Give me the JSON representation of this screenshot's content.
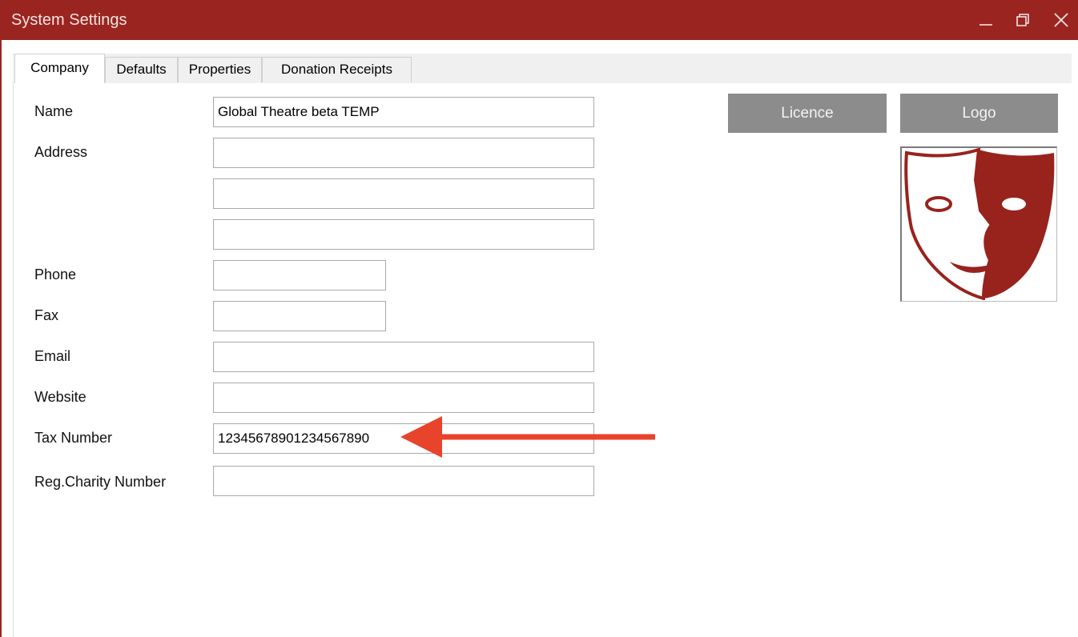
{
  "window": {
    "title": "System Settings",
    "accent_color": "#9a2520",
    "controls": [
      "minimize-icon",
      "restore-icon",
      "close-icon"
    ]
  },
  "tabs": [
    {
      "label": "Company",
      "active": true
    },
    {
      "label": "Defaults",
      "active": false
    },
    {
      "label": "Properties",
      "active": false
    },
    {
      "label": "Donation Receipts",
      "active": false
    }
  ],
  "form": {
    "name_label": "Name",
    "name_value": "Global Theatre beta TEMP",
    "address_label": "Address",
    "address_line1": "",
    "address_line2": "",
    "address_line3": "",
    "phone_label": "Phone",
    "phone_value": "",
    "fax_label": "Fax",
    "fax_value": "",
    "email_label": "Email",
    "email_value": "",
    "website_label": "Website",
    "website_value": "",
    "tax_label": "Tax Number",
    "tax_value": "12345678901234567890",
    "charity_label": "Reg.Charity Number",
    "charity_value": ""
  },
  "buttons": {
    "licence_label": "Licence",
    "logo_label": "Logo"
  },
  "logo": {
    "icon": "theatre-mask-icon",
    "color": "#98231c"
  },
  "annotation": {
    "icon": "arrow-left-icon",
    "color": "#e8432b"
  }
}
